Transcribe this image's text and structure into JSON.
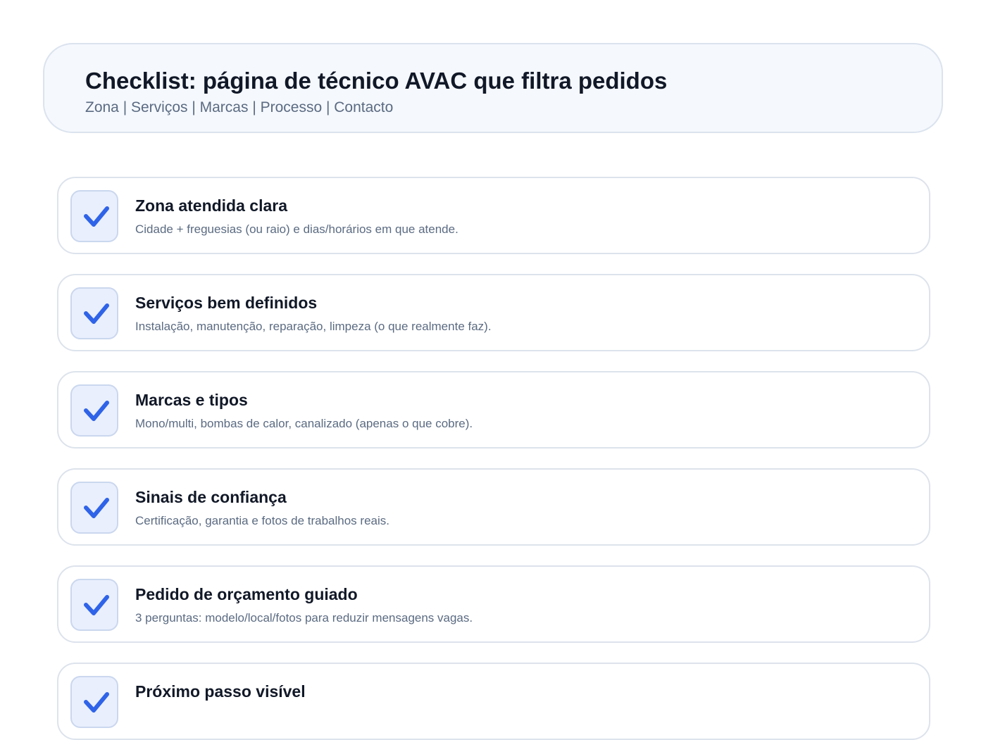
{
  "header": {
    "title": "Checklist: página de técnico AVAC que filtra pedidos",
    "nav": "Zona | Serviços | Marcas | Processo | Contacto"
  },
  "checklist": {
    "items": [
      {
        "title": "Zona atendida clara",
        "desc": "Cidade + freguesias (ou raio) e dias/horários em que atende.",
        "checked": true
      },
      {
        "title": "Serviços bem definidos",
        "desc": "Instalação, manutenção, reparação, limpeza (o que realmente faz).",
        "checked": true
      },
      {
        "title": "Marcas e tipos",
        "desc": "Mono/multi, bombas de calor, canalizado (apenas o que cobre).",
        "checked": true
      },
      {
        "title": "Sinais de confiança",
        "desc": "Certificação, garantia e fotos de trabalhos reais.",
        "checked": true
      },
      {
        "title": "Pedido de orçamento guiado",
        "desc": "3 perguntas: modelo/local/fotos para reduzir mensagens vagas.",
        "checked": true
      },
      {
        "title": "Próximo passo visível",
        "desc": "",
        "checked": true
      }
    ]
  },
  "colors": {
    "check": "#2f63e8",
    "check_bg": "#e9effd",
    "title": "#111827",
    "muted": "#5b6b82",
    "border": "#dde3ec"
  },
  "icons": {
    "check": "checkmark-icon"
  }
}
